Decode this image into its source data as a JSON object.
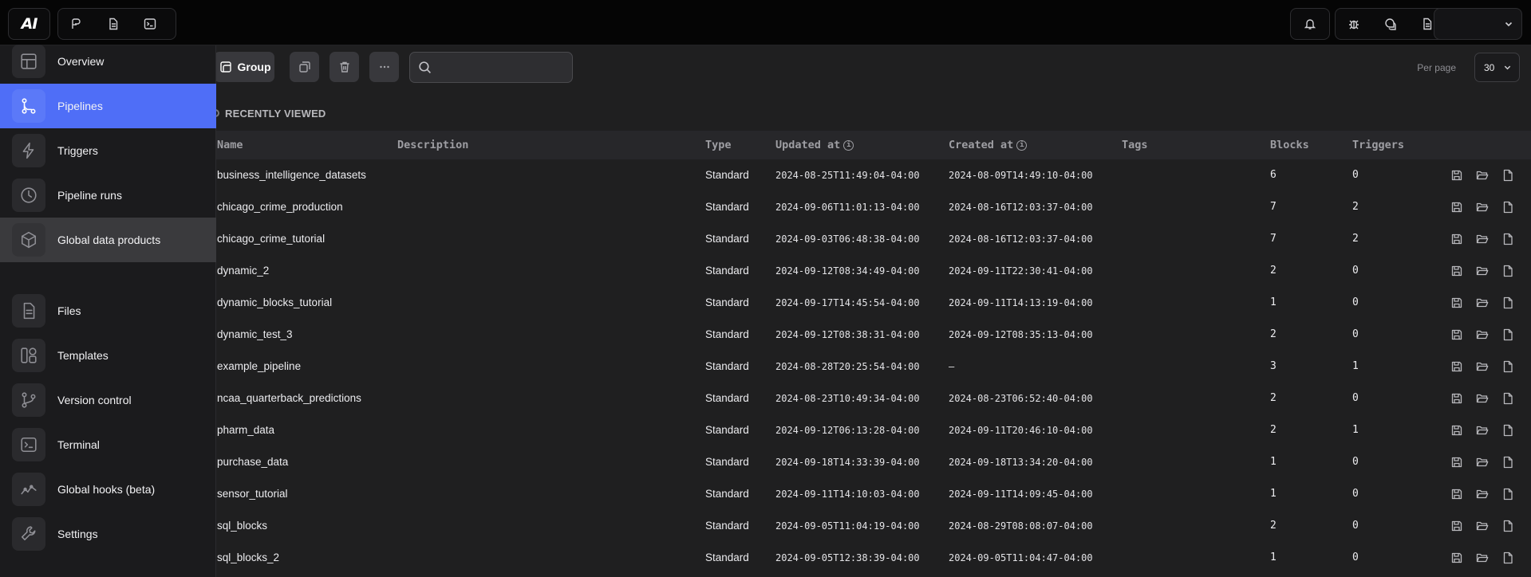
{
  "app": {
    "logo_text": "AI"
  },
  "topbar": {
    "left_icons": [
      "pipeline-icon",
      "file-icon",
      "terminal-icon"
    ],
    "right_icons": [
      "bell-icon",
      "bug-icon",
      "chat-icon",
      "document-icon"
    ],
    "avatar_menu_icon": "chevron-down-icon"
  },
  "sidebar": {
    "items": [
      {
        "label": "Overview",
        "icon": "layout-icon",
        "state": "normal"
      },
      {
        "label": "Pipelines",
        "icon": "pipeline-icon",
        "state": "active"
      },
      {
        "label": "Triggers",
        "icon": "lightning-icon",
        "state": "normal"
      },
      {
        "label": "Pipeline runs",
        "icon": "clock-icon",
        "state": "normal"
      },
      {
        "label": "Global data products",
        "icon": "cube-icon",
        "state": "hover"
      },
      {
        "label": "Files",
        "icon": "file-icon",
        "state": "normal"
      },
      {
        "label": "Templates",
        "icon": "template-icon",
        "state": "normal"
      },
      {
        "label": "Version control",
        "icon": "branch-icon",
        "state": "normal"
      },
      {
        "label": "Terminal",
        "icon": "terminal-icon",
        "state": "normal"
      },
      {
        "label": "Global hooks (beta)",
        "icon": "hooks-icon",
        "state": "normal"
      },
      {
        "label": "Settings",
        "icon": "wrench-icon",
        "state": "normal"
      }
    ]
  },
  "toolbar": {
    "group_label": "Group",
    "search_placeholder": "",
    "per_page_label": "Per page",
    "per_page_value": "30"
  },
  "section_title": "RECENTLY VIEWED",
  "table": {
    "headers": {
      "name": "Name",
      "description": "Description",
      "type": "Type",
      "updated": "Updated at",
      "created": "Created at",
      "tags": "Tags",
      "blocks": "Blocks",
      "triggers": "Triggers"
    },
    "rows": [
      {
        "name": "business_intelligence_datasets",
        "type": "Standard",
        "updated": "2024-08-25T11:49:04-04:00",
        "created": "2024-08-09T14:49:10-04:00",
        "blocks": "6",
        "triggers": "0"
      },
      {
        "name": "chicago_crime_production",
        "type": "Standard",
        "updated": "2024-09-06T11:01:13-04:00",
        "created": "2024-08-16T12:03:37-04:00",
        "blocks": "7",
        "triggers": "2"
      },
      {
        "name": "chicago_crime_tutorial",
        "type": "Standard",
        "updated": "2024-09-03T06:48:38-04:00",
        "created": "2024-08-16T12:03:37-04:00",
        "blocks": "7",
        "triggers": "2"
      },
      {
        "name": "dynamic_2",
        "type": "Standard",
        "updated": "2024-09-12T08:34:49-04:00",
        "created": "2024-09-11T22:30:41-04:00",
        "blocks": "2",
        "triggers": "0"
      },
      {
        "name": "dynamic_blocks_tutorial",
        "type": "Standard",
        "updated": "2024-09-17T14:45:54-04:00",
        "created": "2024-09-11T14:13:19-04:00",
        "blocks": "1",
        "triggers": "0"
      },
      {
        "name": "dynamic_test_3",
        "type": "Standard",
        "updated": "2024-09-12T08:38:31-04:00",
        "created": "2024-09-12T08:35:13-04:00",
        "blocks": "2",
        "triggers": "0"
      },
      {
        "name": "example_pipeline",
        "type": "Standard",
        "updated": "2024-08-28T20:25:54-04:00",
        "created": "—",
        "blocks": "3",
        "triggers": "1"
      },
      {
        "name": "ncaa_quarterback_predictions",
        "type": "Standard",
        "updated": "2024-08-23T10:49:34-04:00",
        "created": "2024-08-23T06:52:40-04:00",
        "blocks": "2",
        "triggers": "0"
      },
      {
        "name": "pharm_data",
        "type": "Standard",
        "updated": "2024-09-12T06:13:28-04:00",
        "created": "2024-09-11T20:46:10-04:00",
        "blocks": "2",
        "triggers": "1"
      },
      {
        "name": "purchase_data",
        "type": "Standard",
        "updated": "2024-09-18T14:33:39-04:00",
        "created": "2024-09-18T13:34:20-04:00",
        "blocks": "1",
        "triggers": "0"
      },
      {
        "name": "sensor_tutorial",
        "type": "Standard",
        "updated": "2024-09-11T14:10:03-04:00",
        "created": "2024-09-11T14:09:45-04:00",
        "blocks": "1",
        "triggers": "0"
      },
      {
        "name": "sql_blocks",
        "type": "Standard",
        "updated": "2024-09-05T11:04:19-04:00",
        "created": "2024-08-29T08:08:07-04:00",
        "blocks": "2",
        "triggers": "0"
      },
      {
        "name": "sql_blocks_2",
        "type": "Standard",
        "updated": "2024-09-05T12:38:39-04:00",
        "created": "2024-09-05T11:04:47-04:00",
        "blocks": "1",
        "triggers": "0"
      }
    ],
    "row_actions": [
      "save-icon",
      "folder-open-icon",
      "file-icon"
    ]
  }
}
